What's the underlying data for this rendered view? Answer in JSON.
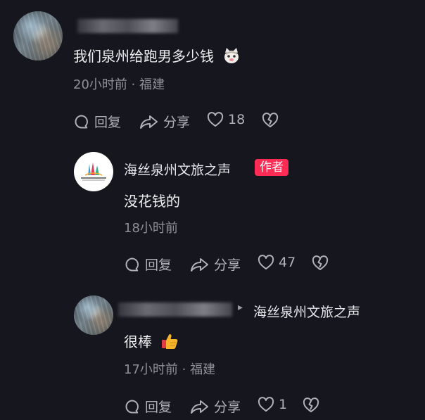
{
  "comment1": {
    "text": "我们泉州给跑男多少钱",
    "time": "20小时前",
    "location": "福建",
    "reply_label": "回复",
    "share_label": "分享",
    "likes": "18"
  },
  "reply1": {
    "author": "海丝泉州文旅之声",
    "badge": "作者",
    "text": "没花钱的",
    "time": "18小时前",
    "reply_label": "回复",
    "share_label": "分享",
    "likes": "47"
  },
  "reply2": {
    "reply_to": "海丝泉州文旅之声",
    "text": "很棒",
    "time": "17小时前",
    "location": "福建",
    "reply_label": "回复",
    "share_label": "分享",
    "likes": "1"
  },
  "meta_separator": "·",
  "reply_arrow": "▸",
  "colors": {
    "background": "#16161e",
    "badge": "#fe2c55",
    "meta": "#8f8f99"
  },
  "icons": [
    "comment-bubble-icon",
    "share-arrow-icon",
    "heart-icon",
    "broken-heart-icon",
    "cat-emoji-icon",
    "thumbs-up-emoji-icon"
  ]
}
